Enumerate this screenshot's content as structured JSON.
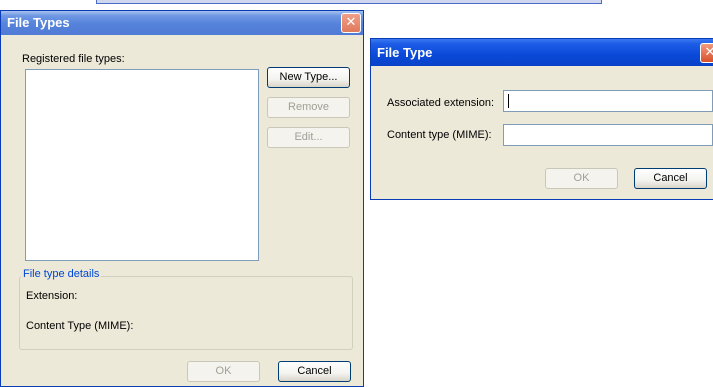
{
  "file_types_dialog": {
    "title": "File Types",
    "close_glyph": "✕",
    "registered_label": "Registered file types:",
    "new_type_label": "New Type...",
    "remove_label": "Remove",
    "edit_label": "Edit...",
    "details_group_label": "File type details",
    "extension_label": "Extension:",
    "content_type_label": "Content Type (MIME):",
    "ok_label": "OK",
    "cancel_label": "Cancel"
  },
  "file_type_dialog": {
    "title": "File Type",
    "close_glyph": "✕",
    "associated_extension_label": "Associated extension:",
    "associated_extension_value": "",
    "content_type_label": "Content type (MIME):",
    "content_type_value": "",
    "ok_label": "OK",
    "cancel_label": "Cancel"
  },
  "colors": {
    "title_text": "#ffffff",
    "dialog_bg": "#ece9d8",
    "group_label": "#0046d5",
    "title_bar_blue": "#0a49d8"
  },
  "icons": {
    "close": "close-icon"
  }
}
